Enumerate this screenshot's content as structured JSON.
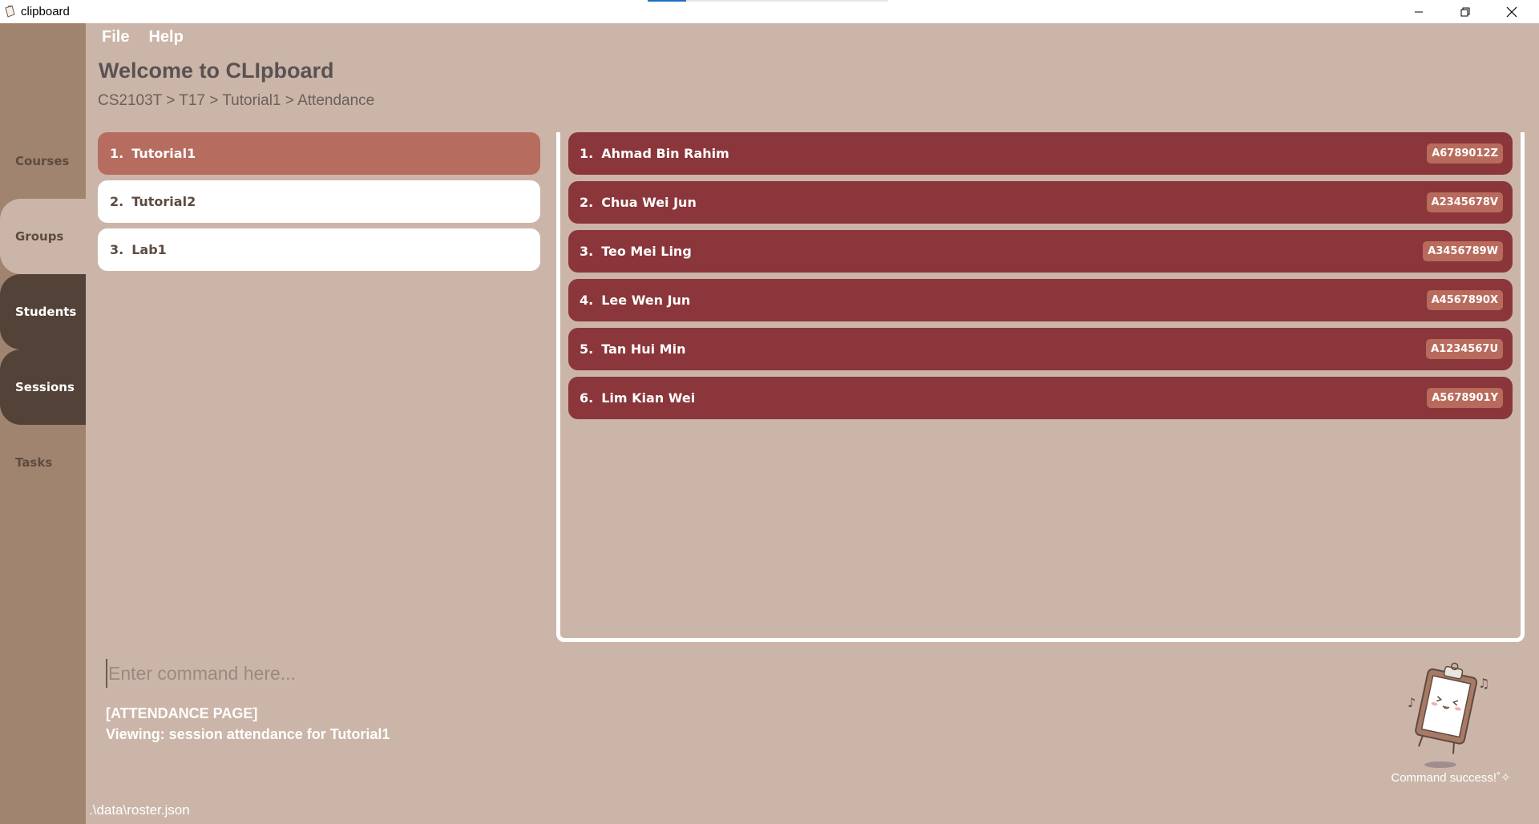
{
  "window": {
    "title": "clipboard",
    "load_progress": 0.16
  },
  "menu": {
    "file": "File",
    "help": "Help"
  },
  "header": {
    "title": "Welcome to CLIpboard",
    "breadcrumb": "CS2103T > T17 > Tutorial1 > Attendance"
  },
  "sidebar": {
    "items": [
      {
        "label": "Courses"
      },
      {
        "label": "Groups"
      },
      {
        "label": "Students"
      },
      {
        "label": "Sessions"
      },
      {
        "label": "Tasks"
      }
    ]
  },
  "groups": [
    {
      "num": "1.",
      "name": "Tutorial1",
      "selected": true
    },
    {
      "num": "2.",
      "name": "Tutorial2",
      "selected": false
    },
    {
      "num": "3.",
      "name": "Lab1",
      "selected": false
    }
  ],
  "students": [
    {
      "num": "1.",
      "name": "Ahmad Bin Rahim",
      "id": "A6789012Z"
    },
    {
      "num": "2.",
      "name": "Chua Wei Jun",
      "id": "A2345678V"
    },
    {
      "num": "3.",
      "name": "Teo Mei Ling",
      "id": "A3456789W"
    },
    {
      "num": "4.",
      "name": "Lee Wen Jun",
      "id": "A4567890X"
    },
    {
      "num": "5.",
      "name": "Tan Hui Min",
      "id": "A1234567U"
    },
    {
      "num": "6.",
      "name": "Lim Kian Wei",
      "id": "A5678901Y"
    }
  ],
  "command": {
    "placeholder": "Enter command here..."
  },
  "result": {
    "line1": "[ATTENDANCE PAGE]",
    "line2": "Viewing: session attendance for Tutorial1"
  },
  "mascot": {
    "status": "Command success!˚✧"
  },
  "status_bar": {
    "path": ".\\data\\roster.json"
  },
  "colors": {
    "background": "#cbb5a8",
    "sidebar": "#a1846f",
    "sidebar_dark": "#524237",
    "selected_group": "#b66c5f",
    "student_row": "#8b363a",
    "badge": "#b86a5c"
  }
}
